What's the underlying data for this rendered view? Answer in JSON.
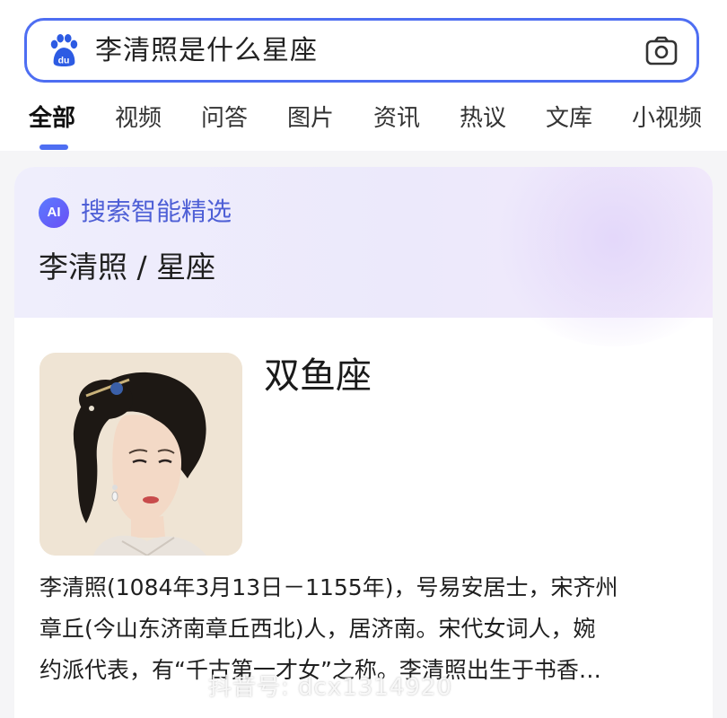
{
  "search": {
    "query": "李清照是什么星座",
    "logo_icon": "baidu-paw-icon",
    "camera_icon": "camera-icon"
  },
  "tabs": [
    {
      "label": "全部",
      "active": true
    },
    {
      "label": "视频",
      "active": false
    },
    {
      "label": "问答",
      "active": false
    },
    {
      "label": "图片",
      "active": false
    },
    {
      "label": "资讯",
      "active": false
    },
    {
      "label": "热议",
      "active": false
    },
    {
      "label": "文库",
      "active": false
    },
    {
      "label": "小视频",
      "active": false
    }
  ],
  "ai_card": {
    "badge": "AI",
    "title": "搜索智能精选",
    "answer_path": "李清照 / 星座"
  },
  "result": {
    "title": "双鱼座",
    "description_lines": [
      "李清照(1084年3月13日－1155年)，号易安居士，宋齐州",
      "章丘(今山东济南章丘西北)人，居济南。宋代女词人，婉",
      "约派代表，有“千古第一才女”之称。李清照出生于书香…"
    ]
  },
  "watermark": "抖音号: dcx1314920",
  "colors": {
    "accent": "#4e6ef2",
    "ai_title": "#4e5fd6",
    "ai_header_bg": "#efeefc"
  }
}
